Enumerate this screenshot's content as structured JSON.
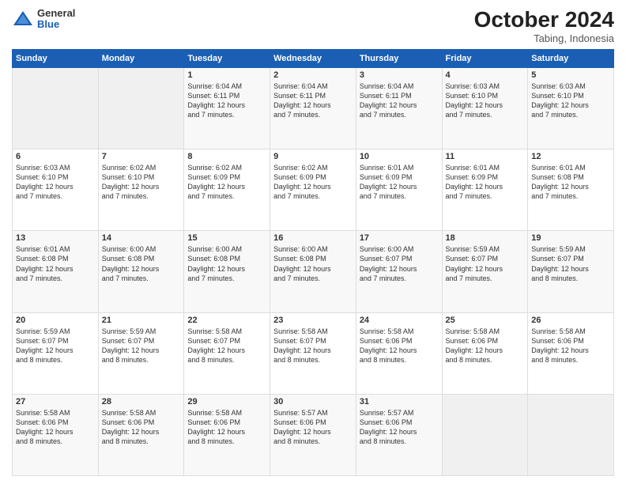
{
  "logo": {
    "general": "General",
    "blue": "Blue"
  },
  "header": {
    "month": "October 2024",
    "location": "Tabing, Indonesia"
  },
  "weekdays": [
    "Sunday",
    "Monday",
    "Tuesday",
    "Wednesday",
    "Thursday",
    "Friday",
    "Saturday"
  ],
  "weeks": [
    [
      {
        "day": "",
        "info": ""
      },
      {
        "day": "",
        "info": ""
      },
      {
        "day": "1",
        "info": "Sunrise: 6:04 AM\nSunset: 6:11 PM\nDaylight: 12 hours\nand 7 minutes."
      },
      {
        "day": "2",
        "info": "Sunrise: 6:04 AM\nSunset: 6:11 PM\nDaylight: 12 hours\nand 7 minutes."
      },
      {
        "day": "3",
        "info": "Sunrise: 6:04 AM\nSunset: 6:11 PM\nDaylight: 12 hours\nand 7 minutes."
      },
      {
        "day": "4",
        "info": "Sunrise: 6:03 AM\nSunset: 6:10 PM\nDaylight: 12 hours\nand 7 minutes."
      },
      {
        "day": "5",
        "info": "Sunrise: 6:03 AM\nSunset: 6:10 PM\nDaylight: 12 hours\nand 7 minutes."
      }
    ],
    [
      {
        "day": "6",
        "info": "Sunrise: 6:03 AM\nSunset: 6:10 PM\nDaylight: 12 hours\nand 7 minutes."
      },
      {
        "day": "7",
        "info": "Sunrise: 6:02 AM\nSunset: 6:10 PM\nDaylight: 12 hours\nand 7 minutes."
      },
      {
        "day": "8",
        "info": "Sunrise: 6:02 AM\nSunset: 6:09 PM\nDaylight: 12 hours\nand 7 minutes."
      },
      {
        "day": "9",
        "info": "Sunrise: 6:02 AM\nSunset: 6:09 PM\nDaylight: 12 hours\nand 7 minutes."
      },
      {
        "day": "10",
        "info": "Sunrise: 6:01 AM\nSunset: 6:09 PM\nDaylight: 12 hours\nand 7 minutes."
      },
      {
        "day": "11",
        "info": "Sunrise: 6:01 AM\nSunset: 6:09 PM\nDaylight: 12 hours\nand 7 minutes."
      },
      {
        "day": "12",
        "info": "Sunrise: 6:01 AM\nSunset: 6:08 PM\nDaylight: 12 hours\nand 7 minutes."
      }
    ],
    [
      {
        "day": "13",
        "info": "Sunrise: 6:01 AM\nSunset: 6:08 PM\nDaylight: 12 hours\nand 7 minutes."
      },
      {
        "day": "14",
        "info": "Sunrise: 6:00 AM\nSunset: 6:08 PM\nDaylight: 12 hours\nand 7 minutes."
      },
      {
        "day": "15",
        "info": "Sunrise: 6:00 AM\nSunset: 6:08 PM\nDaylight: 12 hours\nand 7 minutes."
      },
      {
        "day": "16",
        "info": "Sunrise: 6:00 AM\nSunset: 6:08 PM\nDaylight: 12 hours\nand 7 minutes."
      },
      {
        "day": "17",
        "info": "Sunrise: 6:00 AM\nSunset: 6:07 PM\nDaylight: 12 hours\nand 7 minutes."
      },
      {
        "day": "18",
        "info": "Sunrise: 5:59 AM\nSunset: 6:07 PM\nDaylight: 12 hours\nand 7 minutes."
      },
      {
        "day": "19",
        "info": "Sunrise: 5:59 AM\nSunset: 6:07 PM\nDaylight: 12 hours\nand 8 minutes."
      }
    ],
    [
      {
        "day": "20",
        "info": "Sunrise: 5:59 AM\nSunset: 6:07 PM\nDaylight: 12 hours\nand 8 minutes."
      },
      {
        "day": "21",
        "info": "Sunrise: 5:59 AM\nSunset: 6:07 PM\nDaylight: 12 hours\nand 8 minutes."
      },
      {
        "day": "22",
        "info": "Sunrise: 5:58 AM\nSunset: 6:07 PM\nDaylight: 12 hours\nand 8 minutes."
      },
      {
        "day": "23",
        "info": "Sunrise: 5:58 AM\nSunset: 6:07 PM\nDaylight: 12 hours\nand 8 minutes."
      },
      {
        "day": "24",
        "info": "Sunrise: 5:58 AM\nSunset: 6:06 PM\nDaylight: 12 hours\nand 8 minutes."
      },
      {
        "day": "25",
        "info": "Sunrise: 5:58 AM\nSunset: 6:06 PM\nDaylight: 12 hours\nand 8 minutes."
      },
      {
        "day": "26",
        "info": "Sunrise: 5:58 AM\nSunset: 6:06 PM\nDaylight: 12 hours\nand 8 minutes."
      }
    ],
    [
      {
        "day": "27",
        "info": "Sunrise: 5:58 AM\nSunset: 6:06 PM\nDaylight: 12 hours\nand 8 minutes."
      },
      {
        "day": "28",
        "info": "Sunrise: 5:58 AM\nSunset: 6:06 PM\nDaylight: 12 hours\nand 8 minutes."
      },
      {
        "day": "29",
        "info": "Sunrise: 5:58 AM\nSunset: 6:06 PM\nDaylight: 12 hours\nand 8 minutes."
      },
      {
        "day": "30",
        "info": "Sunrise: 5:57 AM\nSunset: 6:06 PM\nDaylight: 12 hours\nand 8 minutes."
      },
      {
        "day": "31",
        "info": "Sunrise: 5:57 AM\nSunset: 6:06 PM\nDaylight: 12 hours\nand 8 minutes."
      },
      {
        "day": "",
        "info": ""
      },
      {
        "day": "",
        "info": ""
      }
    ]
  ]
}
